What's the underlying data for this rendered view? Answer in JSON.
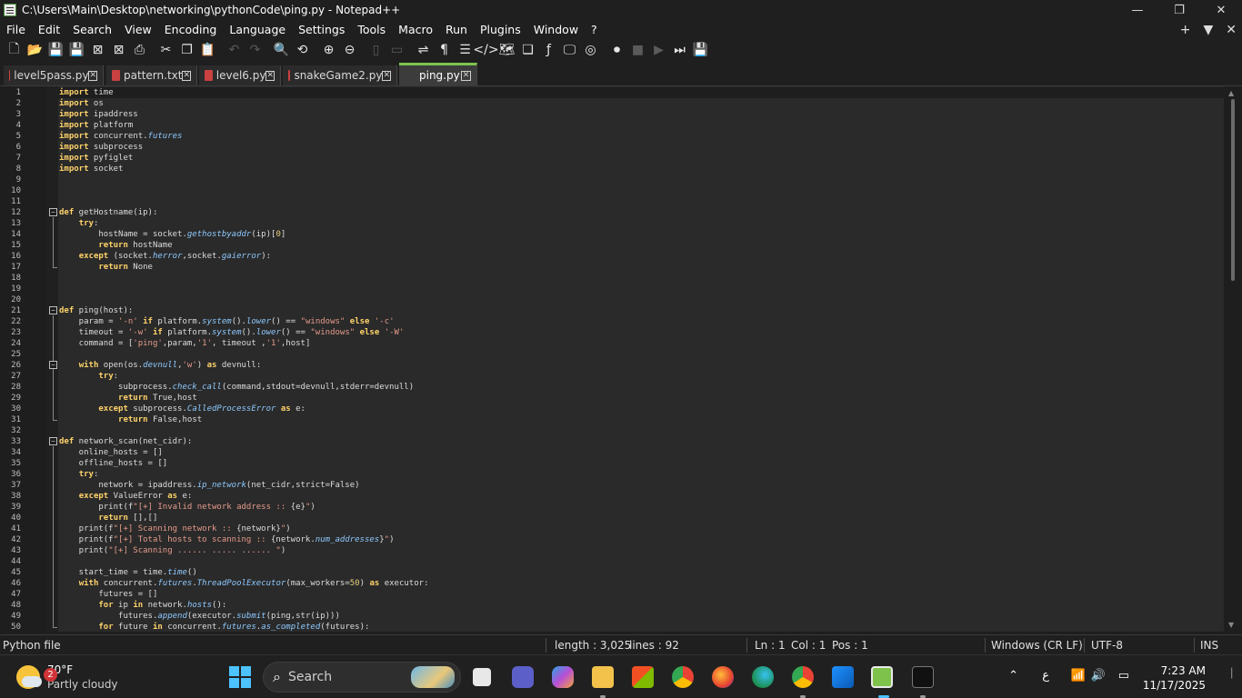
{
  "window": {
    "title": "C:\\Users\\Main\\Desktop\\networking\\pythonCode\\ping.py - Notepad++",
    "minimize": "—",
    "maximize": "❐",
    "close": "✕"
  },
  "menu": {
    "items": [
      "File",
      "Edit",
      "Search",
      "View",
      "Encoding",
      "Language",
      "Settings",
      "Tools",
      "Macro",
      "Run",
      "Plugins",
      "Window",
      "?"
    ],
    "right": [
      "+",
      "▼",
      "✕"
    ]
  },
  "tabs": [
    {
      "label": "level5pass.py",
      "active": false
    },
    {
      "label": "pattern.txt",
      "active": false
    },
    {
      "label": "level6.py",
      "active": false
    },
    {
      "label": "snakeGame2.py",
      "active": false
    },
    {
      "label": "ping.py",
      "active": true
    }
  ],
  "code_lines": [
    "<span class=\"kw\">import</span> time",
    "<span class=\"kw\">import</span> os",
    "<span class=\"kw\">import</span> ipaddress",
    "<span class=\"kw\">import</span> platform",
    "<span class=\"kw\">import</span> concurrent.<span class=\"fn\">futures</span>",
    "<span class=\"kw\">import</span> subprocess",
    "<span class=\"kw\">import</span> pyfiglet",
    "<span class=\"kw\">import</span> socket",
    "",
    "",
    "",
    "<span class=\"kw\">def</span> getHostname(ip):",
    "    <span class=\"kw\">try</span>:",
    "        hostName = socket.<span class=\"fn\">gethostbyaddr</span>(ip)[<span class=\"num\">0</span>]",
    "        <span class=\"kw\">return</span> hostName",
    "    <span class=\"kw\">except</span> (socket.<span class=\"fn\">herror</span>,socket.<span class=\"fn\">gaierror</span>):",
    "        <span class=\"kw\">return</span> None",
    "",
    "",
    "",
    "<span class=\"kw\">def</span> ping(host):",
    "    param = <span class=\"str\">'-n'</span> <span class=\"kw\">if</span> platform.<span class=\"fn\">system</span>().<span class=\"fn\">lower</span>() == <span class=\"str\">\"windows\"</span> <span class=\"kw\">else</span> <span class=\"str\">'-c'</span>",
    "    timeout = <span class=\"str\">'-w'</span> <span class=\"kw\">if</span> platform.<span class=\"fn\">system</span>().<span class=\"fn\">lower</span>() == <span class=\"str\">\"windows\"</span> <span class=\"kw\">else</span> <span class=\"str\">'-W'</span>",
    "    command = [<span class=\"str\">'ping'</span>,param,<span class=\"str\">'1'</span>, timeout ,<span class=\"str\">'1'</span>,host]",
    "",
    "    <span class=\"kw\">with</span> open(os.<span class=\"fn\">devnull</span>,<span class=\"str\">'w'</span>) <span class=\"kw\">as</span> devnull:",
    "        <span class=\"kw\">try</span>:",
    "            subprocess.<span class=\"fn\">check_call</span>(command,stdout=devnull,stderr=devnull)",
    "            <span class=\"kw\">return</span> True,host",
    "        <span class=\"kw\">except</span> subprocess.<span class=\"fn\">CalledProcessError</span> <span class=\"kw\">as</span> e:",
    "            <span class=\"kw\">return</span> False,host",
    "",
    "<span class=\"kw\">def</span> network_scan(net_cidr):",
    "    online_hosts = []",
    "    offline_hosts = []",
    "    <span class=\"kw\">try</span>:",
    "        network = ipaddress.<span class=\"fn\">ip_network</span>(net_cidr,strict=False)",
    "    <span class=\"kw\">except</span> ValueError <span class=\"kw\">as</span> e:",
    "        print(f<span class=\"str\">\"[+] Invalid network address :: </span>{e}<span class=\"str\">\"</span>)",
    "        <span class=\"kw\">return</span> [],[]",
    "    print(f<span class=\"str\">\"[+] Scanning network :: </span>{network}<span class=\"str\">\"</span>)",
    "    print(f<span class=\"str\">\"[+] Total hosts to scanning :: </span>{network.<span class=\"fn\">num_addresses</span>}<span class=\"str\">\"</span>)",
    "    print(<span class=\"str\">\"[+] Scanning ...... ..... ...... \"</span>)",
    "",
    "    start_time = time.<span class=\"fn\">time</span>()",
    "    <span class=\"kw\">with</span> concurrent.<span class=\"fn\">futures</span>.<span class=\"fn\">ThreadPoolExecutor</span>(max_workers=<span class=\"num\">50</span>) <span class=\"kw\">as</span> executor:",
    "        futures = []",
    "        <span class=\"kw\">for</span> ip <span class=\"kw\">in</span> network.<span class=\"fn\">hosts</span>():",
    "            futures.<span class=\"fn\">append</span>(executor.<span class=\"fn\">submit</span>(ping,str(ip)))",
    "        <span class=\"kw\">for</span> future <span class=\"kw\">in</span> concurrent.<span class=\"fn\">futures</span>.<span class=\"fn\">as_completed</span>(futures):"
  ],
  "status": {
    "file_type": "Python file",
    "length": "length : 3,025",
    "lines": "lines : 92",
    "ln": "Ln : 1",
    "col": "Col : 1",
    "pos": "Pos : 1",
    "eol": "Windows (CR LF)",
    "encoding": "UTF-8",
    "mode": "INS"
  },
  "taskbar": {
    "weather_temp": "70°F",
    "weather_cond": "Partly cloudy",
    "weather_badge": "2",
    "search_label": "Search",
    "lang": "ع",
    "time": "7:23 AM",
    "date": "11/17/2025"
  }
}
